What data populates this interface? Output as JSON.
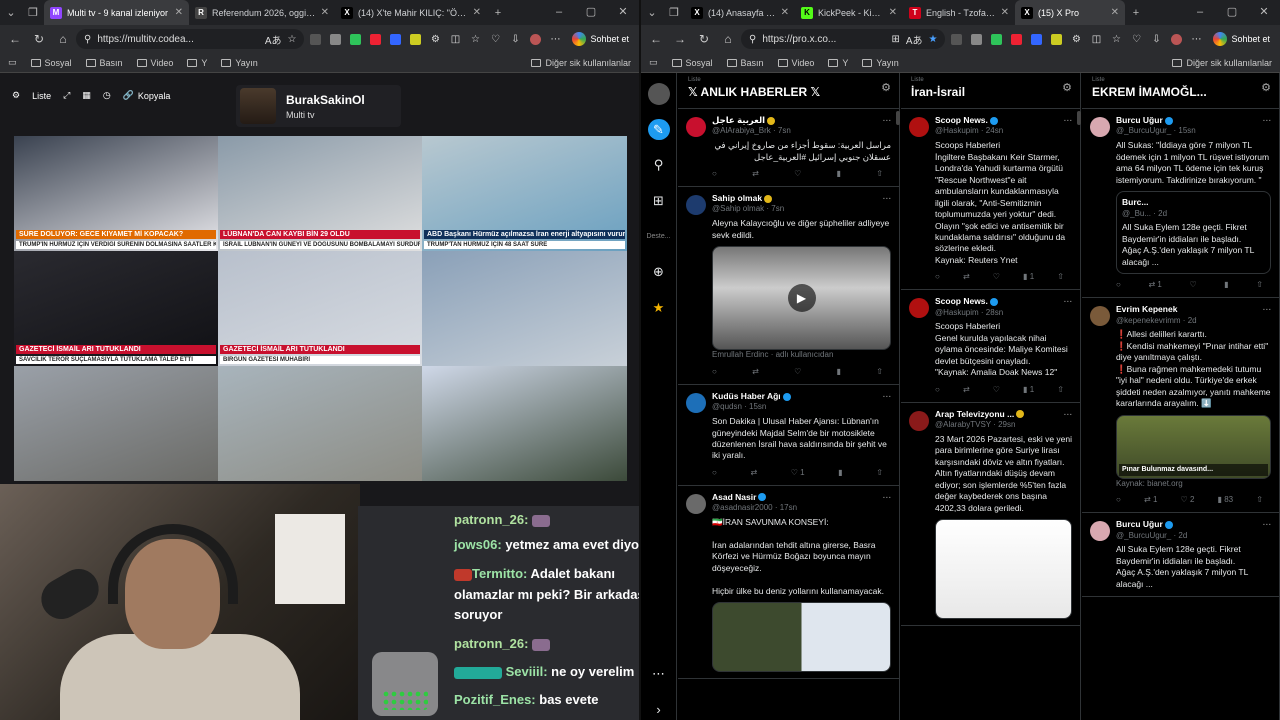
{
  "left": {
    "tabs": [
      {
        "label": "Multi tv - 9 kanal izleniyor",
        "color": "#9146ff",
        "g": "M",
        "active": true
      },
      {
        "label": "Referendum 2026, oggi si vota:",
        "color": "#444",
        "g": "R"
      },
      {
        "label": "(14) X'te Mahir KILIÇ: \"ÖĞRENC",
        "color": "#000",
        "g": "X"
      }
    ],
    "url": "https://multitv.codea...",
    "chat_label": "Sohbet et",
    "bookmarks": [
      "Sosyal",
      "Basın",
      "Video",
      "Y",
      "Yayın"
    ],
    "bookmarks_more": "Diğer sik kullanılanlar",
    "mtv": {
      "liste": "Liste",
      "kopyala": "Kopyala",
      "profile_name": "BurakSakinOl",
      "profile_sub": "Multi tv"
    },
    "cells": [
      {
        "c1": "#3a4250",
        "c2": "#e8e8ec",
        "cap": "SÜRE DOLUYOR: GECE KIYAMET Mİ KOPACAK?",
        "capbg": "#e06a00",
        "sub": "TRUMP'IN HÜRMÜZ İÇİN VERDİĞİ SÜRENİN DOLMASINA SAATLER KALDI"
      },
      {
        "c1": "#8a9aa8",
        "c2": "#e0e0e0",
        "cap": "LÜBNAN'DA CAN KAYBI BİN 29 OLDU",
        "capbg": "#c8102e",
        "sub": "İSRAİL LÜBNAN'IN GÜNEYİ VE DOĞUSUNU BOMBALAMAYI SÜRDÜRÜYOR"
      },
      {
        "c1": "#b8c8d0",
        "c2": "#6aa0c0",
        "cap": "ABD Başkanı Hürmüz açılmazsa İran enerji altyapısını vururuz",
        "capbg": "#10305a",
        "sub": "TRUMP'TAN HÜRMÜZ İÇİN 48 SAAT SÜRE"
      },
      {
        "c1": "#2a2a30",
        "c2": "#101014",
        "cap": "GAZETECİ İSMAİL ARI TUTUKLANDI",
        "capbg": "#c8102e",
        "sub": "SAVCILIK TERÖR SUÇLAMASIYLA TUTUKLAMA TALEP ETTİ"
      },
      {
        "c1": "#b8c0cc",
        "c2": "#d8dce2",
        "cap": "GAZETECİ İSMAİL ARI TUTUKLANDI",
        "capbg": "#c8102e",
        "sub": "BİRGÜN GAZETESİ MUHABİRİ"
      },
      {
        "c1": "#8aa0b8",
        "c2": "#c8d0d8",
        "cap": "",
        "capbg": "",
        "sub": ""
      },
      {
        "c1": "#9aa0a8",
        "c2": "#6a6a66",
        "cap": "",
        "capbg": "",
        "sub": ""
      },
      {
        "c1": "#a8b4bc",
        "c2": "#8c8c84",
        "cap": "",
        "capbg": "",
        "sub": ""
      },
      {
        "c1": "#cfd8e8",
        "c2": "#3c4a3a",
        "cap": "",
        "capbg": "",
        "sub": ""
      }
    ],
    "chat": [
      {
        "user": "patronn_26:",
        "msg": ""
      },
      {
        "user": "jows06:",
        "msg": "yetmez ama evet diyorum"
      },
      {
        "user": "Termitto:",
        "msg": "Adalet bakanı"
      },
      {
        "user": "",
        "msg": "olamazlar mı peki? Bir arkadaş"
      },
      {
        "user": "",
        "msg": "soruyor"
      },
      {
        "user": "patronn_26:",
        "msg": ""
      },
      {
        "user": "Seviiil:",
        "msg": "ne oy verelim"
      },
      {
        "user": "Pozitif_Enes:",
        "msg": "bas evete"
      }
    ]
  },
  "right": {
    "tabs": [
      {
        "label": "(14) Anasayfa / X",
        "color": "#000",
        "g": "X"
      },
      {
        "label": "KickPeek - Kick.com",
        "color": "#53fc18",
        "g": "K"
      },
      {
        "label": "English - Tzofar - Re",
        "color": "#d0021b",
        "g": "T"
      },
      {
        "label": "(15) X Pro",
        "color": "#000",
        "g": "X",
        "active": true
      }
    ],
    "url": "https://pro.x.co...",
    "chat_label": "Sohbet et",
    "bookmarks": [
      "Sosyal",
      "Basın",
      "Video",
      "Y",
      "Yayın"
    ],
    "bookmarks_more": "Diğer sik kullanılanlar",
    "deste": "Deste...",
    "col_label": "Liste",
    "cols": [
      {
        "title": "𝕏 ANLIK HABERLER 𝕏",
        "tweets": [
          {
            "name": "العربية عاجل",
            "handle": "@AlArabiya_Brk · 7sn",
            "text": "مراسل العربية: سقوط أجزاء من صاروخ إيراني في عسقلان جنوبي إسرائيل #العربية_عاجل",
            "av": "#c8102e",
            "ver": "g",
            "acts": [
              "",
              "",
              "",
              "",
              ""
            ]
          },
          {
            "name": "Sahip olmak",
            "handle": "@Sahip olmak · 7sn",
            "text": "Aleyna Kalaycıoğlu ve diğer şüpheliler adliyeye sevk edildi.",
            "av": "#1d3b6e",
            "ver": "g",
            "media": "video",
            "mh": 104,
            "foot": "Emrullah Erdinc · adlı kullanıcıdan",
            "acts": [
              "",
              "",
              "",
              "",
              ""
            ]
          },
          {
            "name": "Kudüs Haber Ağı",
            "handle": "@qudsn · 15sn",
            "text": "Son Dakika | Ulusal Haber Ajansı: Lübnan'ın güneyindeki Majdal Selm'de bir motosiklete düzenlenen İsrail hava saldırısında bir şehit ve iki yaralı.",
            "av": "#1d6fb8",
            "ver": "b",
            "acts": [
              "",
              "",
              "1",
              "",
              ""
            ]
          },
          {
            "name": "Asad Nasir",
            "handle": "@asadnasir2000 · 17sn",
            "text": "🇮🇷İRAN SAVUNMA KONSEYİ:\n\nİran adalarından tehdit altına girerse, Basra Körfezi ve Hürmüz Boğazı boyunca mayın döşeyeceğiz.\n\nHiçbir ülke bu deniz yollarını kullanamayacak.",
            "av": "#6a6a6a",
            "ver": "b",
            "media": "photo",
            "mh": 70,
            "acts": []
          }
        ]
      },
      {
        "title": "İran-İsrail",
        "tweets": [
          {
            "name": "Scoop News.",
            "handle": "@Haskupim · 24sn",
            "text": "Scoops Haberleri\nİngiltere Başbakanı Keir Starmer, Londra'da Yahudi kurtarma örgütü \"Rescue Northwest\"e ait ambulansların kundaklanmasıyla ilgili olarak, \"Anti-Semitizmin toplumumuzda yeri yoktur\" dedi. Olayın \"şok edici ve antisemitik bir kundaklama saldırısı\" olduğunu da sözlerine ekledi.\nKaynak: Reuters Ynet",
            "av": "#b01010",
            "ver": "b",
            "acts": [
              "",
              "",
              "",
              "1",
              ""
            ]
          },
          {
            "name": "Scoop News.",
            "handle": "@Haskupim · 28sn",
            "text": "Scoops Haberleri\nGenel kurulda yapılacak nihai oylama öncesinde: Maliye Komitesi devlet bütçesini onayladı.\n\"Kaynak: Amalia Doak News 12\"",
            "av": "#b01010",
            "ver": "b",
            "acts": [
              "",
              "",
              "",
              "1",
              ""
            ]
          },
          {
            "name": "Arap Televizyonu ...",
            "handle": "@AlarabyTVSY · 29sn",
            "text": "23 Mart 2026 Pazartesi, eski ve yeni para birimlerine göre Suriye lirası karşısındaki döviz ve altın fiyatları.\nAltın fiyatlarındaki düşüş devam ediyor; son işlemlerde %5'ten fazla değer kaybederek ons başına 4202,33 dolara geriledi.",
            "av": "#8a1a1a",
            "ver": "g",
            "media": "info",
            "mh": 100,
            "acts": []
          }
        ]
      },
      {
        "title": "EKREM İMAMOĞL...",
        "tweets": [
          {
            "name": "Burcu Uğur",
            "handle": "@_BurcuUgur_ · 15sn",
            "text": "All Sukas: \"İddiaya göre 7 milyon TL ödemek için 1 milyon TL rüşvet istiyorum ama 64 milyon TL ödeme için tek kuruş istemiyorum. Takdirinize bırakıyorum. \"",
            "av": "#d8a8b0",
            "ver": "b",
            "quote": {
              "name": "Burc...",
              "handle": "@_Bu... · 2d",
              "text": "All Suka Eylem 128e geçti. Fikret Baydemir'in iddiaları ile başladı.\nAğaç A.Ş.'den yaklaşık 7 milyon TL alacağı ..."
            },
            "acts": [
              "",
              "1",
              "",
              "",
              ""
            ]
          },
          {
            "name": "Evrim Kepenek",
            "handle": "@kepenekevrimm · 2d",
            "text": "❗Allesi delilleri kararttı.\n❗Kendisi mahkemeyi \"Pınar intihar etti\" diye yanıltmaya çalıştı.\n❗Buna rağmen mahkemedeki tutumu \"iyi hal\" nedeni oldu. Türkiye'de erkek şiddeti neden azalmıyor, yanıtı mahkeme kararlarında arayalım. ⬇️",
            "av": "#7a5a3a",
            "ver": "",
            "media": "sign",
            "mh": 64,
            "mcap": "Pınar Bulunmaz davasınd...",
            "foot": "Kaynak: bianet.org",
            "acts": [
              "",
              "1",
              "2",
              "83",
              ""
            ]
          },
          {
            "name": "Burcu Uğur",
            "handle": "@_BurcuUgur_ · 2d",
            "text": "All Suka Eylem 128e geçti. Fikret Baydemir'in iddiaları ile başladı.\nAğaç A.Ş.'den yaklaşık 7 milyon TL alacağı ...",
            "av": "#d8a8b0",
            "ver": "b",
            "acts": []
          }
        ]
      }
    ]
  }
}
